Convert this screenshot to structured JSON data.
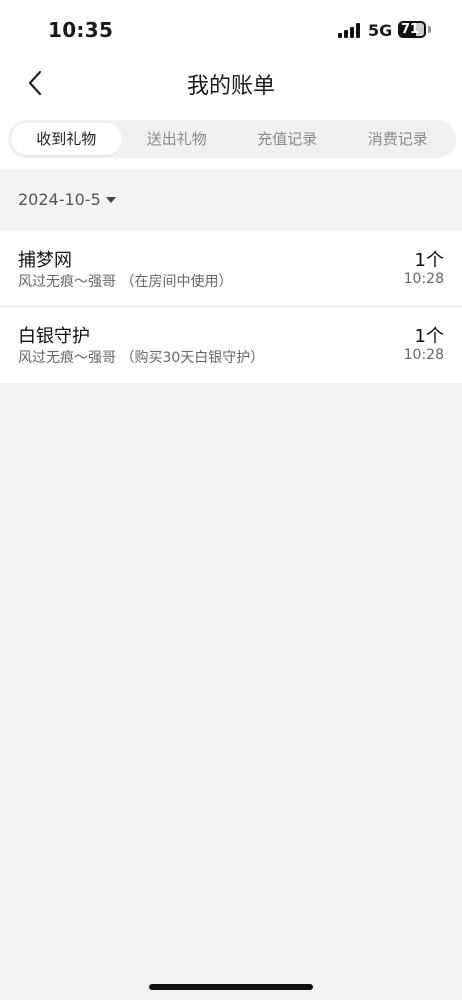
{
  "status_bar": {
    "time": "10:35",
    "network": "5G",
    "battery": "71"
  },
  "header": {
    "title": "我的账单",
    "back_icon": "chevron-left-icon"
  },
  "tabs": [
    {
      "label": "收到礼物",
      "active": true
    },
    {
      "label": "送出礼物",
      "active": false
    },
    {
      "label": "充值记录",
      "active": false
    },
    {
      "label": "消费记录",
      "active": false
    }
  ],
  "date_filter": {
    "value": "2024-10-5",
    "icon": "caret-down-icon"
  },
  "records": [
    {
      "title": "捕梦网",
      "description": "风过无痕～强哥 （在房间中使用）",
      "count": "1个",
      "time": "10:28"
    },
    {
      "title": "白银守护",
      "description": "风过无痕～强哥 （购买30天白银守护）",
      "count": "1个",
      "time": "10:28"
    }
  ]
}
